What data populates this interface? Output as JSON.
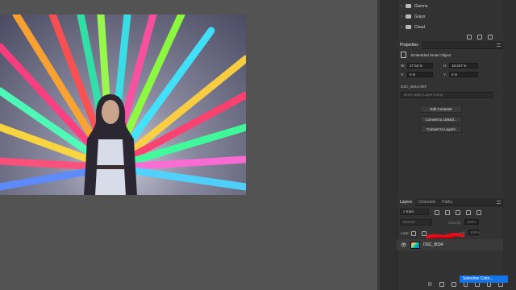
{
  "swatches": {
    "groups": [
      {
        "label": "Greens"
      },
      {
        "label": "Grays"
      },
      {
        "label": "Cloud"
      }
    ]
  },
  "properties": {
    "tab": "Properties",
    "object_type": "Embedded Smart Object",
    "w_label": "W:",
    "w_value": "27.52 in",
    "h_label": "H:",
    "h_value": "18.347 in",
    "x_label": "X:",
    "x_value": "0 in",
    "y_label": "Y:",
    "y_value": "0 in",
    "filename": "DSC_8034.NEF",
    "layer_comp_placeholder": "Don't Apply Layer Comp",
    "btn_edit": "Edit Contents",
    "btn_convert_linked": "Convert to Linked...",
    "btn_convert_layers": "Convert to Layers"
  },
  "layers": {
    "tabs": [
      "Layers",
      "Channels",
      "Paths"
    ],
    "kind_label": "Kind",
    "blend_mode": "Normal",
    "opacity_label": "Opacity:",
    "opacity_value": "100%",
    "lock_label": "Lock:",
    "fill_label": "Fill:",
    "fill_value": "100%",
    "layer_name": "DSC_8034"
  },
  "tooltip": "Selective Color...",
  "colors": {
    "tooltip_bg": "#1473e6",
    "panel_bg": "#323232",
    "canvas_bg": "#535353",
    "scribble": "#e0101a"
  }
}
